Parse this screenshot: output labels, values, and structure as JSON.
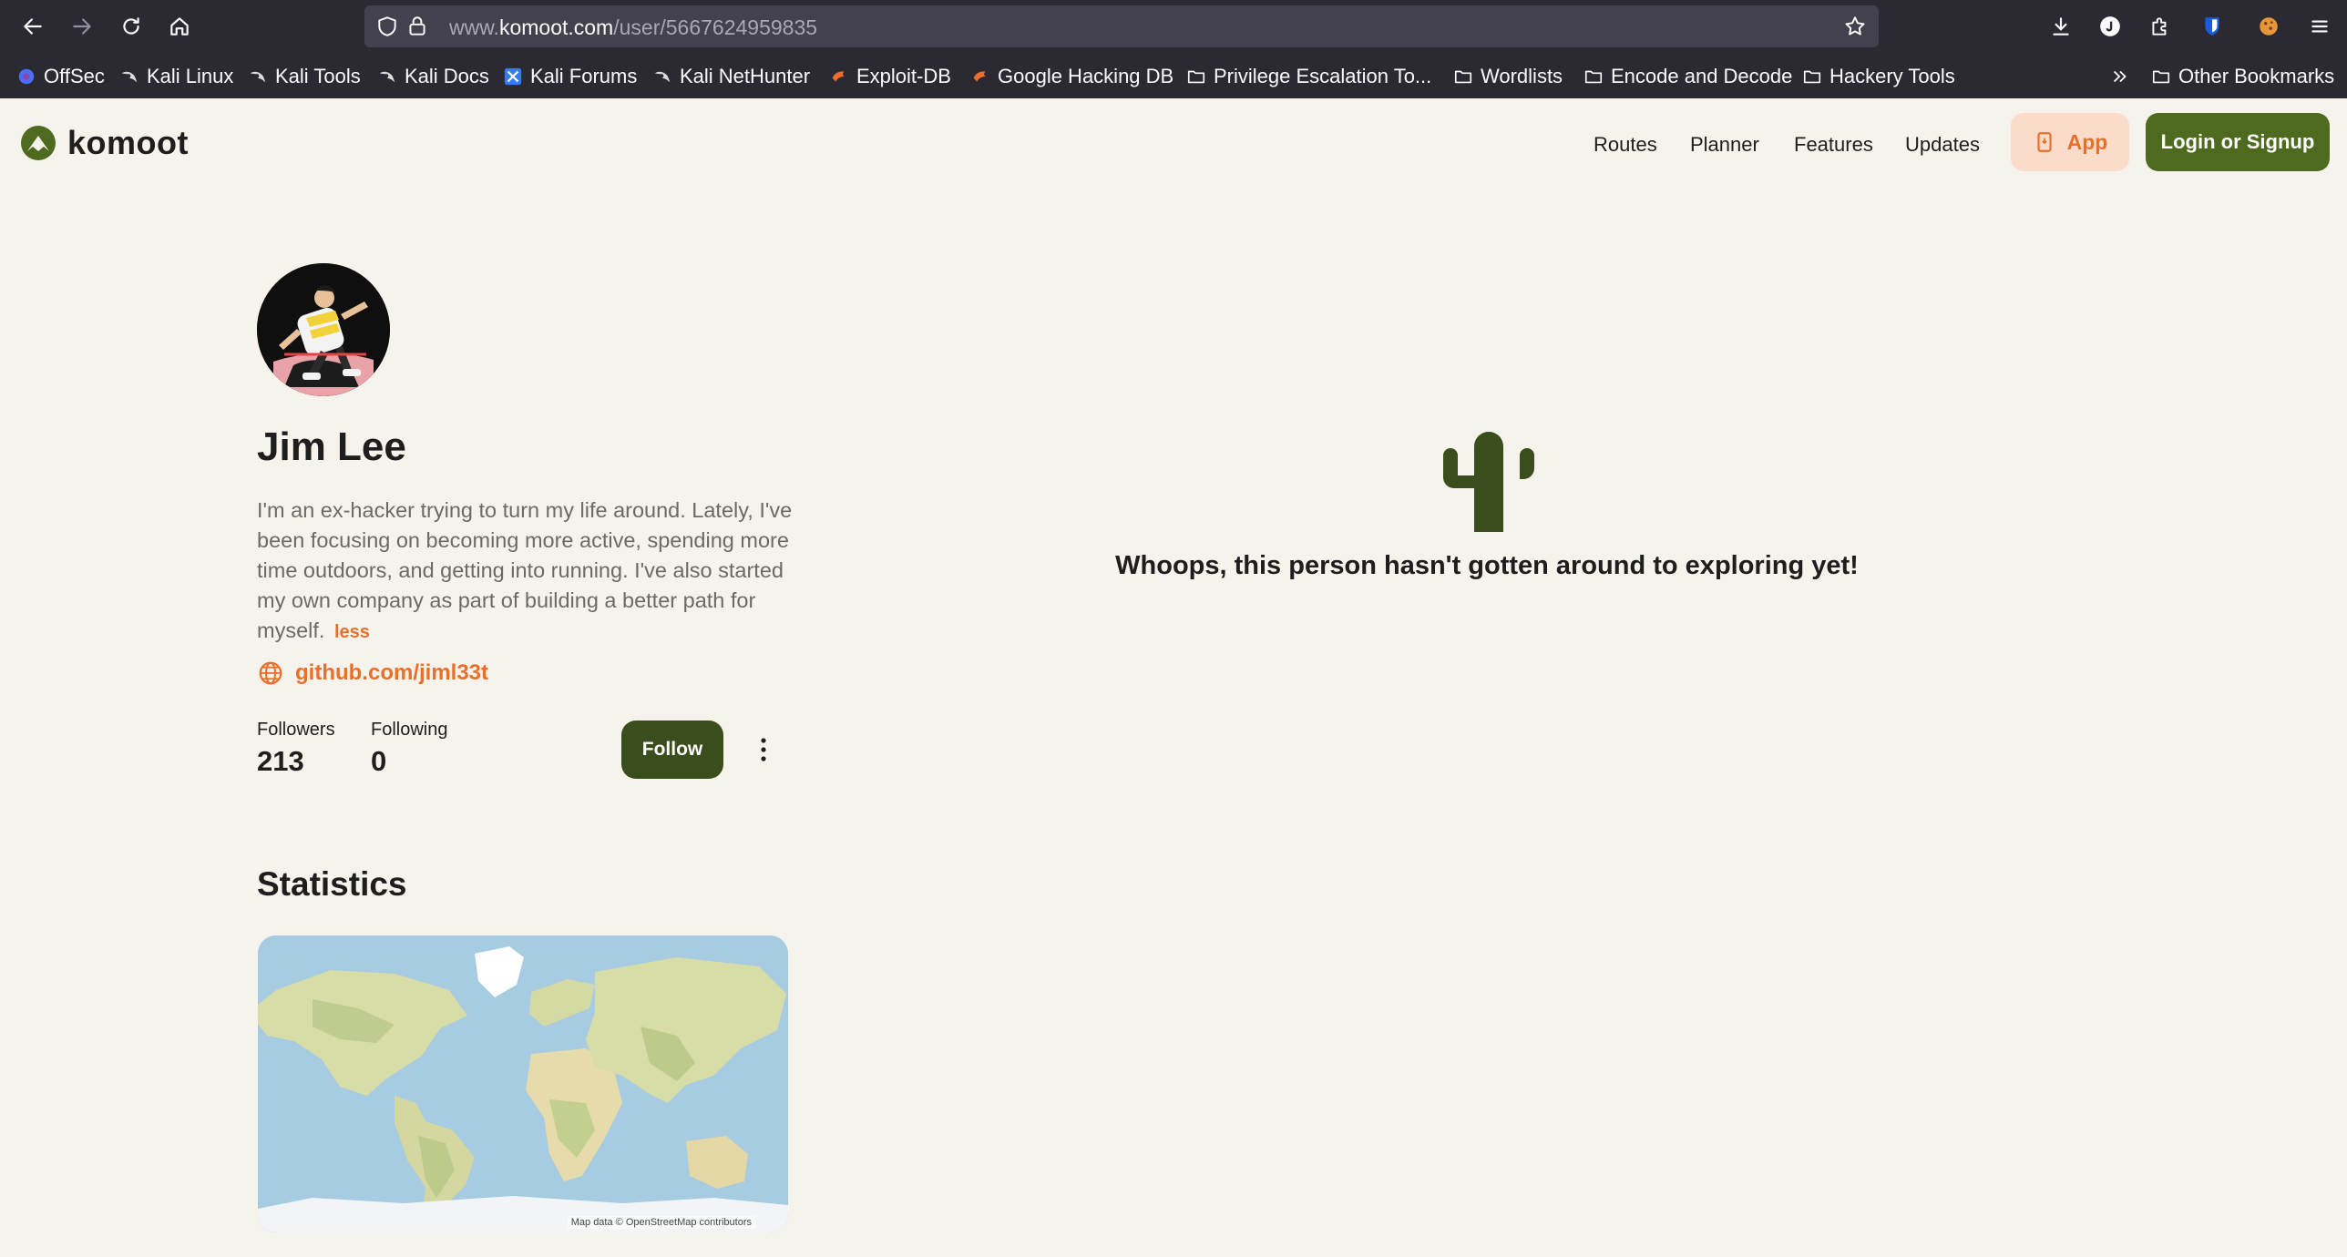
{
  "browser": {
    "url_prefix": "www.",
    "url_domain": "komoot.com",
    "url_path": "/user/5667624959835",
    "bookmarks": [
      {
        "label": "OffSec",
        "icon": "offsec-icon"
      },
      {
        "label": "Kali Linux",
        "icon": "kali-dragon-icon"
      },
      {
        "label": "Kali Tools",
        "icon": "kali-dragon-icon"
      },
      {
        "label": "Kali Docs",
        "icon": "kali-dragon-icon"
      },
      {
        "label": "Kali Forums",
        "icon": "kali-forums-icon"
      },
      {
        "label": "Kali NetHunter",
        "icon": "kali-dragon-icon"
      },
      {
        "label": "Exploit-DB",
        "icon": "exploit-db-icon"
      },
      {
        "label": "Google Hacking DB",
        "icon": "exploit-db-icon"
      },
      {
        "label": "Privilege Escalation To...",
        "icon": "folder-icon"
      },
      {
        "label": "Wordlists",
        "icon": "folder-icon"
      },
      {
        "label": "Encode and Decode",
        "icon": "folder-icon"
      },
      {
        "label": "Hackery Tools",
        "icon": "folder-icon"
      }
    ],
    "other_bookmarks": "Other Bookmarks"
  },
  "site": {
    "logo_text": "komoot",
    "nav": [
      "Routes",
      "Planner",
      "Features",
      "Updates"
    ],
    "app_label": "App",
    "login_label": "Login or Signup",
    "brand_color": "#4d6a1e",
    "accent_color": "#e8702a"
  },
  "profile": {
    "name": "Jim Lee",
    "bio": "I'm an ex-hacker trying to turn my life around. Lately, I've been focusing on becoming more active, spending more time outdoors, and getting into running. I've also started my own company as part of building a better path for myself.",
    "bio_toggle": "less",
    "website": "github.com/jiml33t",
    "followers_label": "Followers",
    "followers_count": "213",
    "following_label": "Following",
    "following_count": "0",
    "follow_label": "Follow"
  },
  "statistics": {
    "title": "Statistics",
    "map_credit": "Map data © OpenStreetMap contributors"
  },
  "empty_state": {
    "icon": "cactus-icon",
    "message": "Whoops, this person hasn't gotten around to exploring yet!"
  }
}
